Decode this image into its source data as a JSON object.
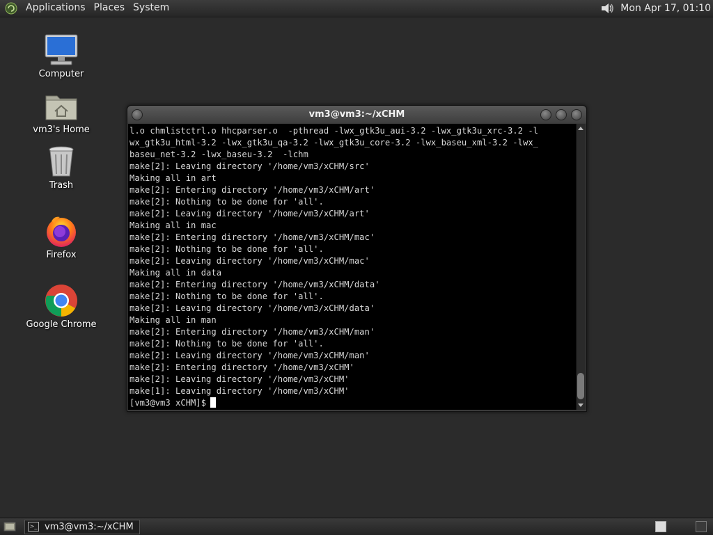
{
  "top_panel": {
    "menu": [
      "Applications",
      "Places",
      "System"
    ],
    "clock": "Mon Apr 17, 01:10"
  },
  "desktop": {
    "icons": [
      {
        "label": "Computer",
        "icon": "computer-icon"
      },
      {
        "label": "vm3's Home",
        "icon": "home-folder-icon"
      },
      {
        "label": "Trash",
        "icon": "trash-icon"
      },
      {
        "label": "Firefox",
        "icon": "firefox-icon"
      },
      {
        "label": "Google Chrome",
        "icon": "chrome-icon"
      }
    ]
  },
  "terminal": {
    "title": "vm3@vm3:~/xCHM",
    "lines": [
      "l.o chmlistctrl.o hhcparser.o  -pthread -lwx_gtk3u_aui-3.2 -lwx_gtk3u_xrc-3.2 -l",
      "wx_gtk3u_html-3.2 -lwx_gtk3u_qa-3.2 -lwx_gtk3u_core-3.2 -lwx_baseu_xml-3.2 -lwx_",
      "baseu_net-3.2 -lwx_baseu-3.2  -lchm",
      "make[2]: Leaving directory '/home/vm3/xCHM/src'",
      "Making all in art",
      "make[2]: Entering directory '/home/vm3/xCHM/art'",
      "make[2]: Nothing to be done for 'all'.",
      "make[2]: Leaving directory '/home/vm3/xCHM/art'",
      "Making all in mac",
      "make[2]: Entering directory '/home/vm3/xCHM/mac'",
      "make[2]: Nothing to be done for 'all'.",
      "make[2]: Leaving directory '/home/vm3/xCHM/mac'",
      "Making all in data",
      "make[2]: Entering directory '/home/vm3/xCHM/data'",
      "make[2]: Nothing to be done for 'all'.",
      "make[2]: Leaving directory '/home/vm3/xCHM/data'",
      "Making all in man",
      "make[2]: Entering directory '/home/vm3/xCHM/man'",
      "make[2]: Nothing to be done for 'all'.",
      "make[2]: Leaving directory '/home/vm3/xCHM/man'",
      "make[2]: Entering directory '/home/vm3/xCHM'",
      "make[2]: Leaving directory '/home/vm3/xCHM'",
      "make[1]: Leaving directory '/home/vm3/xCHM'"
    ],
    "prompt": "[vm3@vm3 xCHM]$"
  },
  "taskbar": {
    "task_label": "vm3@vm3:~/xCHM"
  }
}
